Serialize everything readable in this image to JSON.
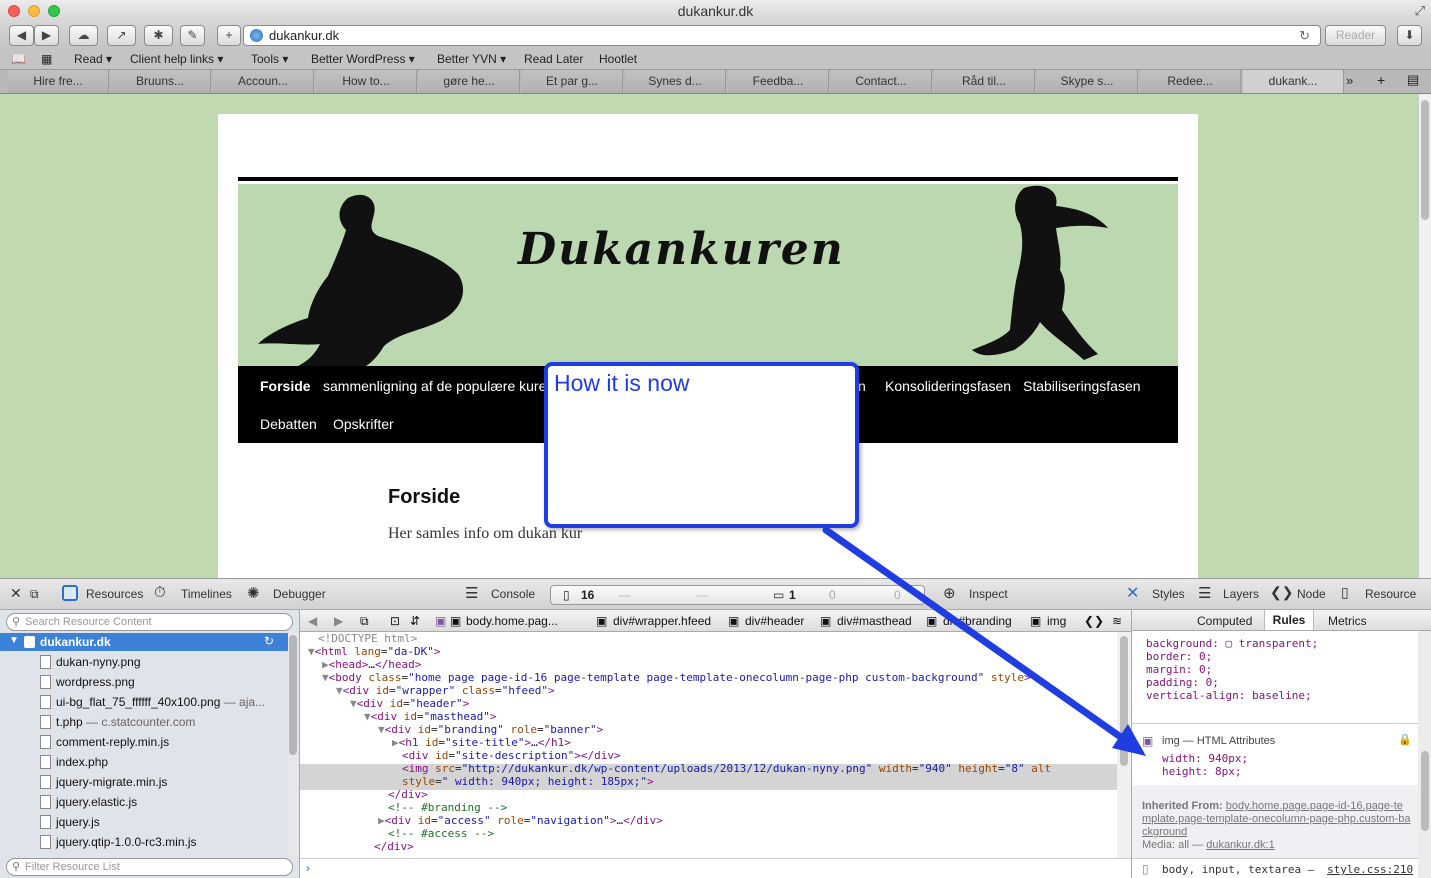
{
  "window": {
    "title": "dukankur.dk"
  },
  "toolbar": {
    "url": "dukankur.dk",
    "reader": "Reader"
  },
  "bookmarks": [
    "Read ▾",
    "Client help links ▾",
    "Tools ▾",
    "Better WordPress ▾",
    "Better YVN ▾",
    "Read Later",
    "Hootlet"
  ],
  "tabs": [
    "Hire fre...",
    "Bruuns...",
    "Accoun...",
    "How to...",
    "gøre he...",
    "Et par g...",
    "Synes d...",
    "Feedba...",
    "Contact...",
    "Råd til...",
    "Skype s...",
    "Redee...",
    "dukank..."
  ],
  "site": {
    "name": "Dukankuren",
    "nav": [
      "Forside",
      "sammenligning af de populære kure",
      "n",
      "Konsolideringsfasen",
      "Stabiliseringsfasen",
      "Debatten",
      "Opskrifter"
    ],
    "page_title": "Forside",
    "page_text": "Her samles info om dukan kur"
  },
  "callout": {
    "text": "How it is now",
    "color": "#1f3de0"
  },
  "devtools": {
    "tabs": [
      "Resources",
      "Timelines",
      "Debugger",
      "Console",
      "Inspect",
      "Styles",
      "Layers",
      "Node",
      "Resource"
    ],
    "counts": [
      "16",
      "—",
      "—",
      "1",
      "0",
      "0"
    ],
    "search_placeholder": "Search Resource Content",
    "filter_placeholder": "Filter Resource List",
    "site": "dukankur.dk",
    "resources": [
      {
        "name": "dukan-nyny.png",
        "extra": ""
      },
      {
        "name": "wordpress.png",
        "extra": ""
      },
      {
        "name": "ui-bg_flat_75_ffffff_40x100.png",
        "extra": " — aja..."
      },
      {
        "name": "t.php",
        "extra": " — c.statcounter.com"
      },
      {
        "name": "comment-reply.min.js",
        "extra": ""
      },
      {
        "name": "index.php",
        "extra": ""
      },
      {
        "name": "jquery-migrate.min.js",
        "extra": ""
      },
      {
        "name": "jquery.elastic.js",
        "extra": ""
      },
      {
        "name": "jquery.js",
        "extra": ""
      },
      {
        "name": "jquery.qtip-1.0.0-rc3.min.js",
        "extra": ""
      }
    ],
    "breadcrumbs": [
      "body.home.pag...",
      "div#wrapper.hfeed",
      "div#header",
      "div#masthead",
      "div#branding",
      "img"
    ],
    "right_tabs": [
      "Computed",
      "Rules",
      "Metrics"
    ],
    "styles": {
      "rules": [
        "background: ▢ transparent;",
        "border: 0;",
        "margin: 0;",
        "padding: 0;",
        "vertical-align: baseline;"
      ],
      "html_attr_title": "img — HTML Attributes",
      "html_attr": [
        "width: 940px;",
        "height: 8px;"
      ],
      "inherited_label": "Inherited From:",
      "inherited_link": "body.home.page.page-id-16.page-template.page-template-onecolumn-page-php.custom-background",
      "media_label": "Media: all —",
      "media_link": "dukankur.dk:1",
      "last_rule": "body, input, textarea —",
      "last_link": "style.css:210"
    }
  }
}
